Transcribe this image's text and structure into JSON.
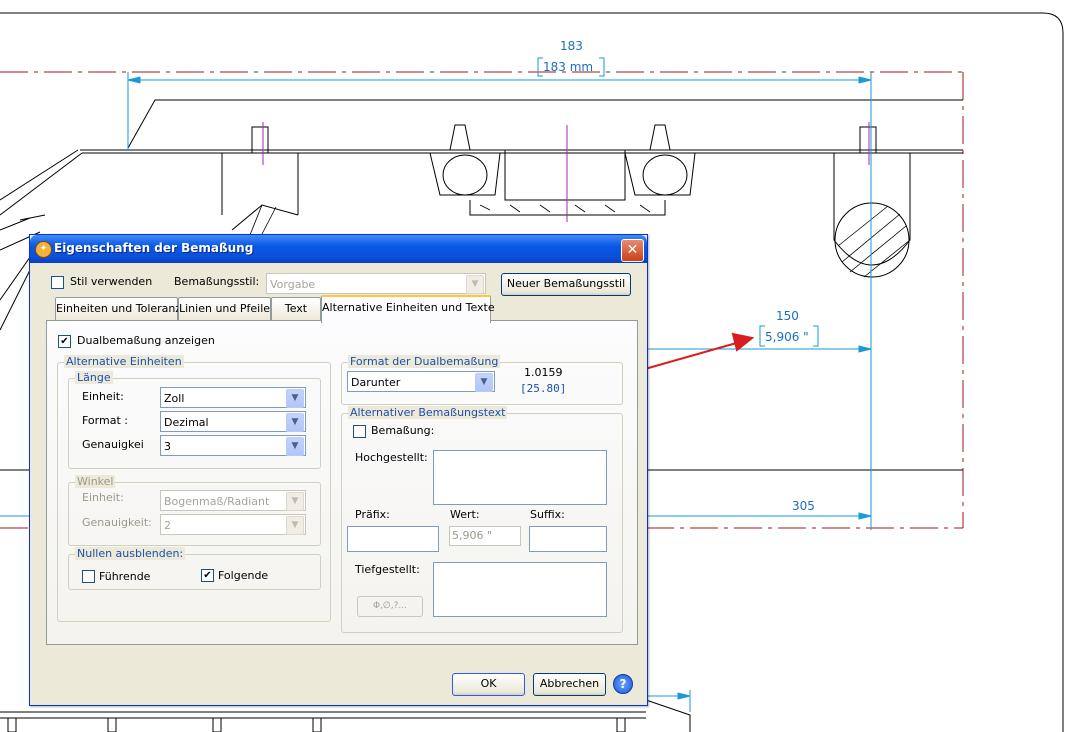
{
  "drawing": {
    "dim_top_value": "183",
    "dim_top_alt": "183 mm",
    "dim_right_value": "150",
    "dim_right_alt": "5,906 \"",
    "dim_bottom_value": "305"
  },
  "dialog": {
    "title": "Eigenschaften der Bemaßung",
    "close_glyph": "✕",
    "style_checkbox_label": "Stil verwenden",
    "style_label": "Bemaßungsstil:",
    "style_value": "Vorgabe",
    "new_style_button": "Neuer Bemaßungsstil",
    "tabs": [
      {
        "label": "Einheiten und Toleranz"
      },
      {
        "label": "Linien und Pfeile"
      },
      {
        "label": "Text"
      },
      {
        "label": "Alternative Einheiten und Texte"
      }
    ],
    "dual_checkbox_label": "Dualbemaßung anzeigen",
    "alt_units": {
      "group": "Alternative Einheiten",
      "length_group": "Länge",
      "unit_label": "Einheit:",
      "unit_value": "Zoll",
      "format_label": "Format :",
      "format_value": "Dezimal",
      "precision_label": "Genauigkei",
      "precision_value": "3"
    },
    "angle": {
      "group": "Winkel",
      "unit_label": "Einheit:",
      "unit_value": "Bogenmaß/Radiant",
      "precision_label": "Genauigkeit:",
      "precision_value": "2"
    },
    "zeros": {
      "group": "Nullen ausblenden:",
      "leading_label": "Führende",
      "trailing_label": "Folgende"
    },
    "dual_format": {
      "group": "Format der Dualbemaßung",
      "value": "Darunter",
      "preview_primary": "1.0159",
      "preview_alt": "[25.80]"
    },
    "alt_text": {
      "group": "Alternativer Bemaßungstext",
      "dim_checkbox_label": "Bemaßung:",
      "superscript_label": "Hochgestellt:",
      "prefix_label": "Präfix:",
      "value_label": "Wert:",
      "value_field": "5,906 \"",
      "suffix_label": "Suffix:",
      "subscript_label": "Tiefgestellt:",
      "symbol_button": "Φ,∅,?..."
    },
    "ok_button": "OK",
    "cancel_button": "Abbrechen",
    "help_glyph": "?"
  },
  "colors": {
    "dim_line": "#1a9ad6",
    "frame_dashed": "#a01818",
    "annotation_arrow": "#d81e1e",
    "title_bar": "#0a58e6"
  }
}
